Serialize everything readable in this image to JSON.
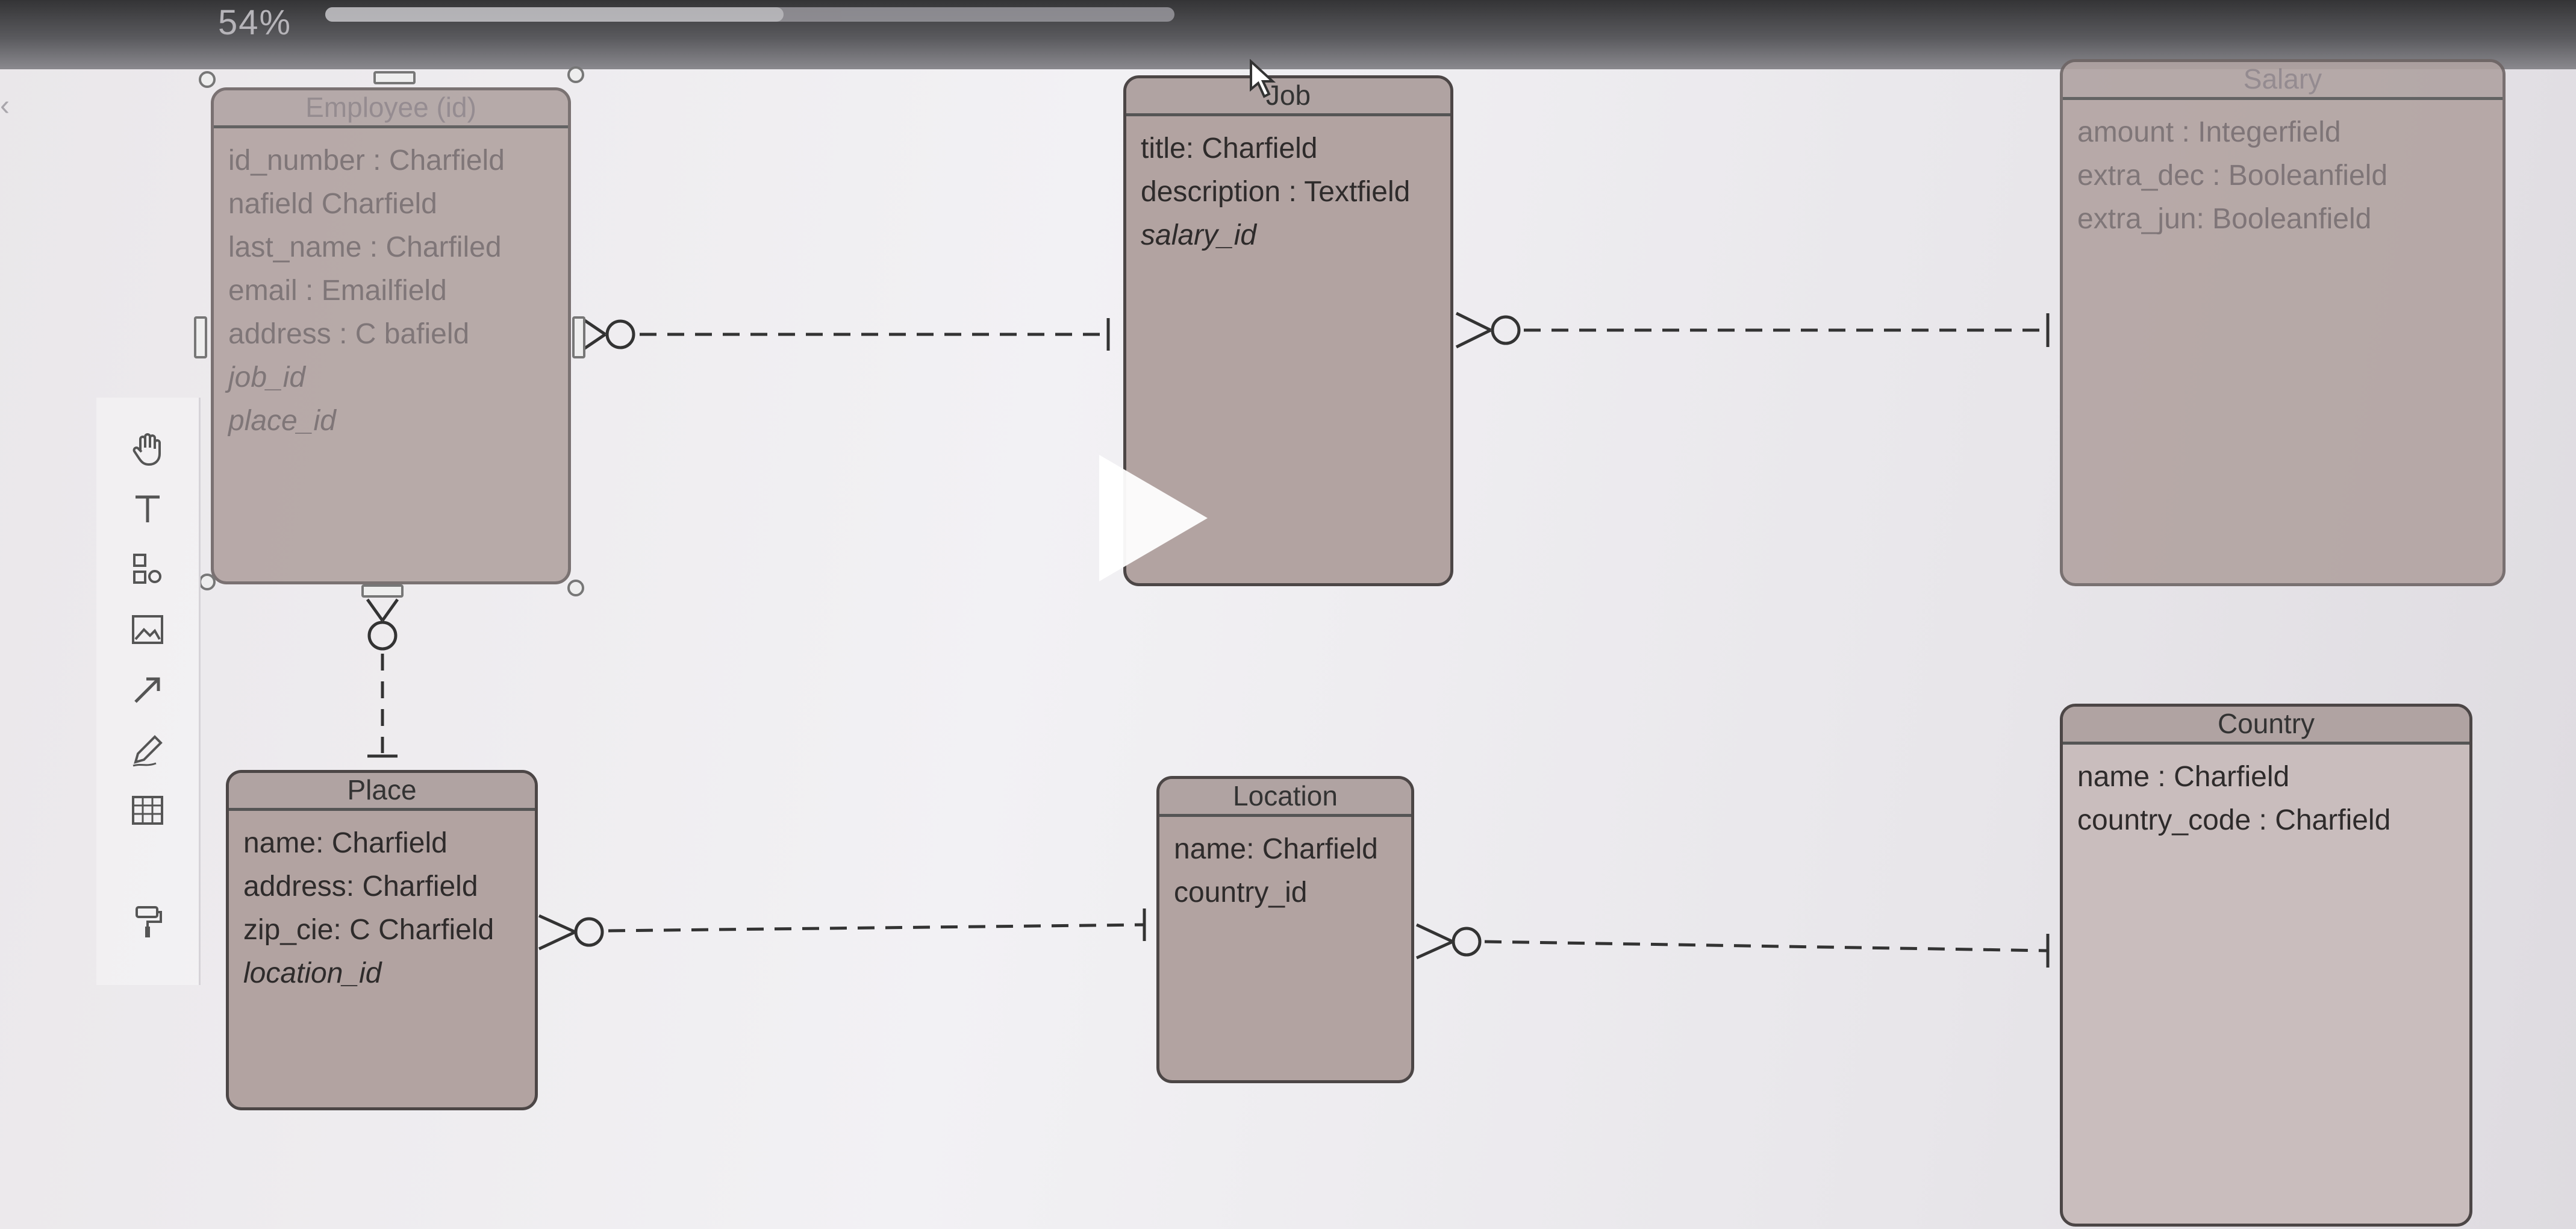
{
  "topbar": {
    "zoom_label": "54%",
    "zoom_level": 0.54
  },
  "toolbar": {
    "tools": [
      {
        "icon": "hand-icon"
      },
      {
        "icon": "text-tool-icon"
      },
      {
        "icon": "shapes-icon"
      },
      {
        "icon": "image-icon"
      },
      {
        "icon": "arrow-icon"
      },
      {
        "icon": "pen-icon"
      },
      {
        "icon": "table-icon"
      },
      {
        "icon": "format-painter-icon"
      }
    ]
  },
  "entities": {
    "employee": {
      "title": "Employee (id)",
      "fields": [
        "id_number : Charfield",
        "nafield Charfield",
        "last_name : Charfiled",
        "email : Emailfield",
        "address : C bafield",
        "job_id",
        "place_id"
      ]
    },
    "job": {
      "title": "Job",
      "fields": [
        "title: Charfield",
        "description : Textfield",
        "salary_id"
      ]
    },
    "salary": {
      "title": "Salary",
      "fields": [
        "amount : Integerfield",
        "extra_dec : Booleanfield",
        "extra_jun: Booleanfield"
      ]
    },
    "place": {
      "title": "Place",
      "fields": [
        "name: Charfield",
        "address: Charfield",
        "zip_cie: C Charfield",
        "location_id"
      ]
    },
    "location": {
      "title": "Location",
      "fields": [
        "name: Charfield",
        "country_id"
      ]
    },
    "country": {
      "title": "Country",
      "fields": [
        "name : Charfield",
        "country_code : Charfield"
      ]
    }
  },
  "colors": {
    "entity_fill": "#b2a3a1",
    "entity_border": "#4c4646",
    "canvas": "#eceaee"
  }
}
